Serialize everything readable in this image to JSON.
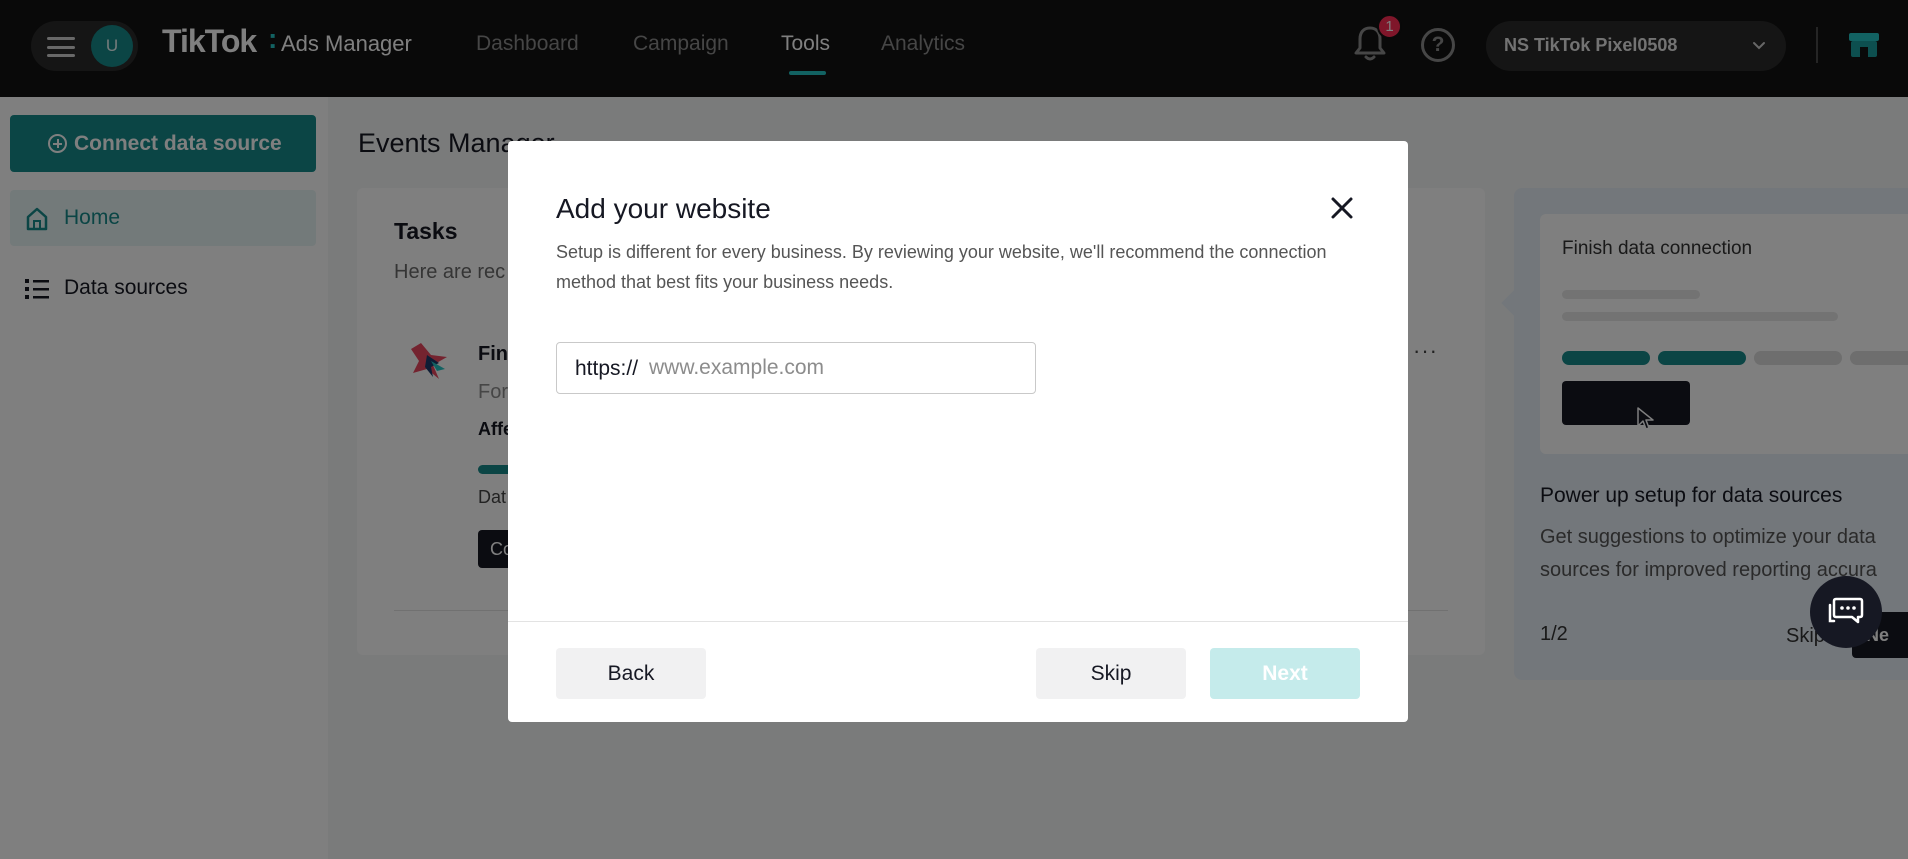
{
  "topbar": {
    "avatar_letter": "U",
    "logo": "TikTok",
    "logo_colon": ":",
    "logo_sub": "Ads Manager",
    "tabs": [
      {
        "label": "Dashboard"
      },
      {
        "label": "Campaign"
      },
      {
        "label": "Tools"
      },
      {
        "label": "Analytics"
      }
    ],
    "active_tab": "Tools",
    "notification_count": "1",
    "help_glyph": "?",
    "account_name": "NS TikTok Pixel0508"
  },
  "sidebar": {
    "connect_label": "Connect data source",
    "items": [
      {
        "label": "Home"
      },
      {
        "label": "Data sources"
      }
    ]
  },
  "main": {
    "page_title": "Events Manager",
    "tasks": {
      "title": "Tasks",
      "subtitle": "Here are rec",
      "task_title": "Fin",
      "task_line2": "For",
      "task_line3": "Affe",
      "task_line4": "Dat",
      "task_button": "Co",
      "more": "···"
    },
    "tip": {
      "inner_title": "Finish data connection",
      "title": "Power up setup for data sources",
      "desc_line1": "Get suggestions to optimize your data",
      "desc_line2": "sources for improved reporting accura",
      "step": "1/2",
      "skip": "Skip",
      "next": "Ne"
    }
  },
  "modal": {
    "title": "Add your website",
    "description": "Setup is different for every business. By reviewing your website, we'll recommend the connection method that best fits your business needs.",
    "url_prefix": "https://",
    "url_value": "",
    "url_placeholder": "www.example.com",
    "back_label": "Back",
    "skip_label": "Skip",
    "next_label": "Next"
  },
  "colors": {
    "brand_teal": "#168b8b",
    "accent_cyan": "#25c4c4",
    "badge_red": "#fe2c55",
    "disabled_next": "#c5ebeb"
  }
}
